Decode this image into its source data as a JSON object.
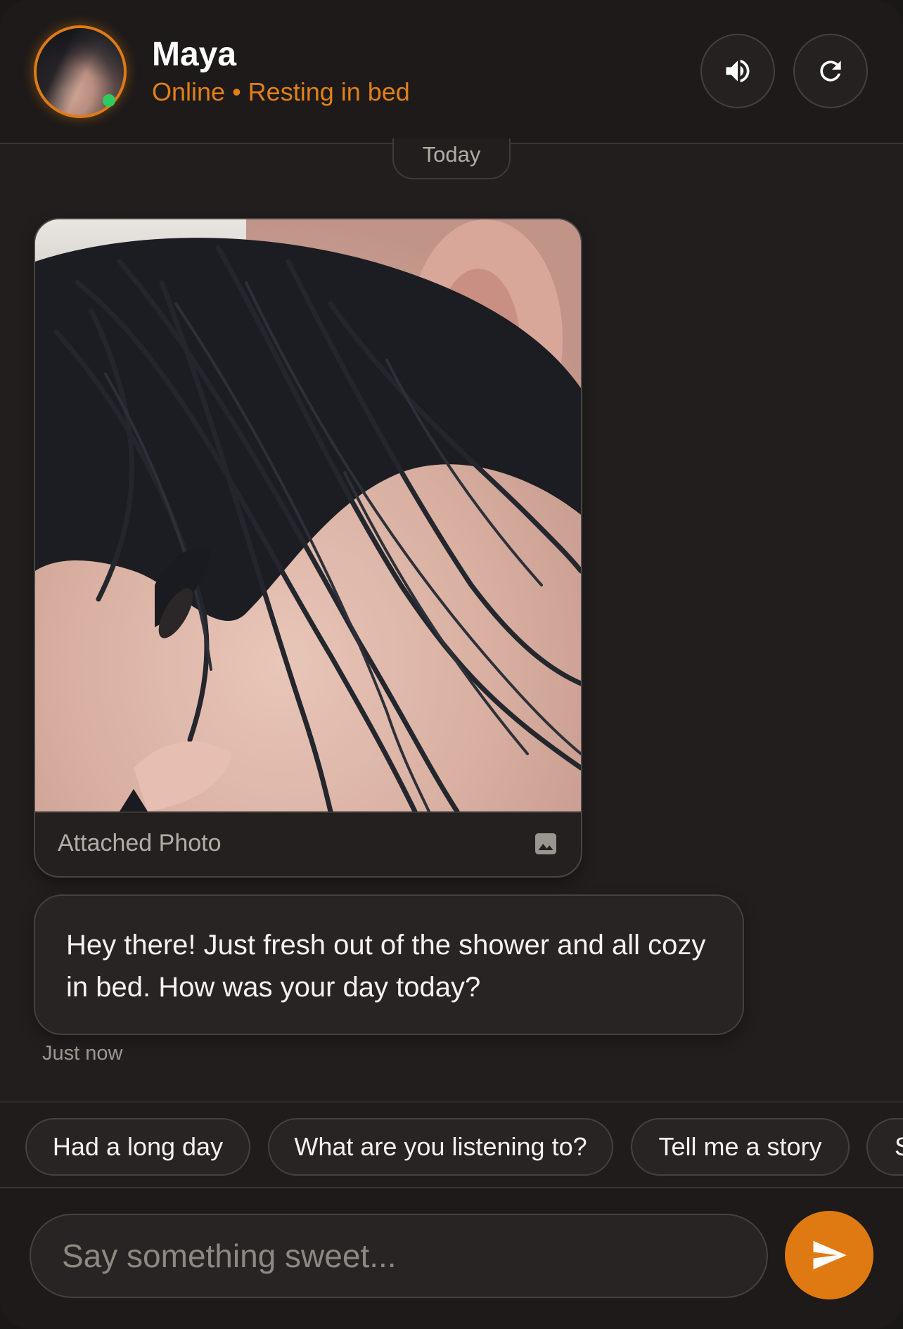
{
  "header": {
    "name": "Maya",
    "status": "Online • Resting in bed",
    "sound_icon": "speaker-icon",
    "refresh_icon": "refresh-icon"
  },
  "chat": {
    "date_label": "Today",
    "attachment": {
      "caption": "Attached Photo",
      "icon": "image-icon"
    },
    "message": {
      "text": "Hey there! Just fresh out of the shower and all cozy in bed. How was your day today?",
      "time": "Just now"
    }
  },
  "quick_replies": [
    "Had a long day",
    "What are you listening to?",
    "Tell me a story",
    "S"
  ],
  "composer": {
    "placeholder": "Say something sweet...",
    "send_icon": "send-icon"
  },
  "colors": {
    "accent": "#df7a12",
    "status": "#e0801a",
    "online": "#2ecc5f",
    "background": "#211e1d"
  }
}
